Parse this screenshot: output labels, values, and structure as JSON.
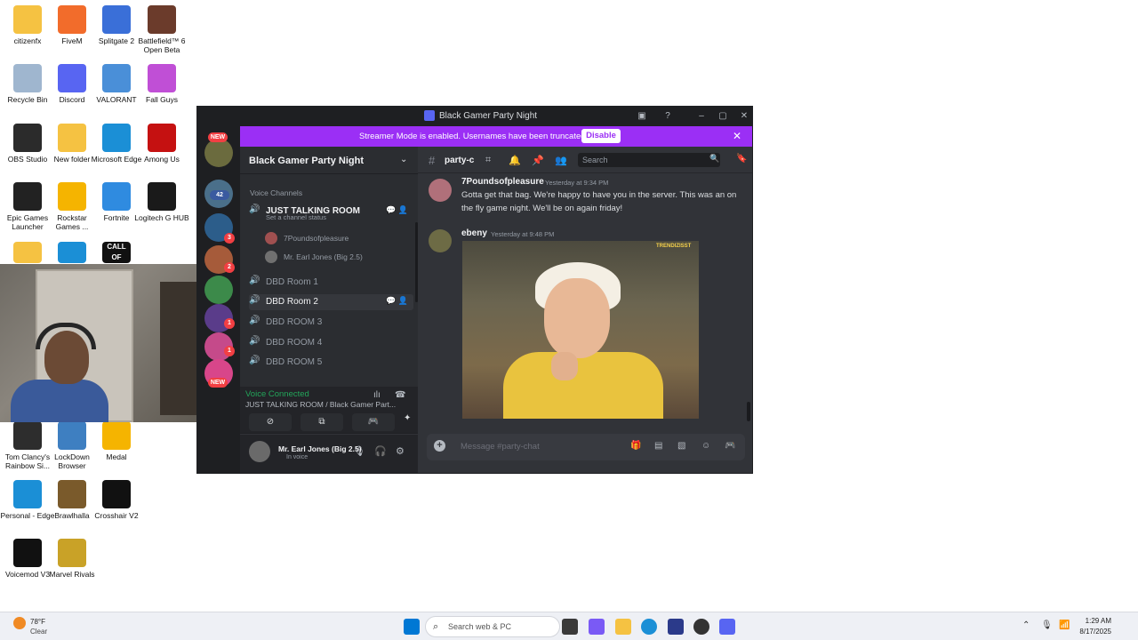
{
  "desktop": {
    "icons": [
      {
        "label": "citizenfx",
        "icon": "folder-icon",
        "color": "#f5c242"
      },
      {
        "label": "FiveM",
        "icon": "fivem-icon",
        "color": "#f26c2b"
      },
      {
        "label": "Splitgate 2",
        "icon": "splitgate-icon",
        "color": "#3a6fd8"
      },
      {
        "label": "Battlefield™ 6 Open Beta",
        "icon": "battlefield-icon",
        "color": "#6b3b2b"
      },
      {
        "label": "Recycle Bin",
        "icon": "recycle-bin-icon",
        "color": "#9fb6cf"
      },
      {
        "label": "Discord",
        "icon": "discord-icon",
        "color": "#5865f2"
      },
      {
        "label": "VALORANT",
        "icon": "valorant-icon",
        "color": "#4a8fd8"
      },
      {
        "label": "Fall Guys",
        "icon": "fall-guys-icon",
        "color": "#c04fd6"
      },
      {
        "label": "OBS Studio",
        "icon": "obs-icon",
        "color": "#2b2b2b"
      },
      {
        "label": "New folder",
        "icon": "folder-icon",
        "color": "#f5c242"
      },
      {
        "label": "Microsoft Edge",
        "icon": "edge-icon",
        "color": "#1b8fd6"
      },
      {
        "label": "Among Us",
        "icon": "among-us-icon",
        "color": "#c51111"
      },
      {
        "label": "Epic Games Launcher",
        "icon": "epic-games-icon",
        "color": "#222222"
      },
      {
        "label": "Rockstar Games ...",
        "icon": "rockstar-icon",
        "color": "#f5b400"
      },
      {
        "label": "Fortnite",
        "icon": "fortnite-icon",
        "color": "#2f8be0"
      },
      {
        "label": "Logitech G HUB",
        "icon": "logitech-icon",
        "color": "#1a1a1a"
      },
      {
        "label": "Tom Clancy's Rainbow Si...",
        "icon": "rainbow-six-icon",
        "color": "#2d2d2d"
      },
      {
        "label": "LockDown Browser",
        "icon": "lockdown-icon",
        "color": "#3e7fc1"
      },
      {
        "label": "Medal",
        "icon": "medal-icon",
        "color": "#f5b400"
      },
      {
        "label": "Personal - Edge",
        "icon": "edge-icon",
        "color": "#1b8fd6"
      },
      {
        "label": "Brawlhalla",
        "icon": "brawlhalla-icon",
        "color": "#7a5a2b"
      },
      {
        "label": "Crosshair V2",
        "icon": "crosshair-icon",
        "color": "#111111"
      },
      {
        "label": "Voicemod V3",
        "icon": "voicemod-icon",
        "color": "#111111"
      },
      {
        "label": "Marvel Rivals",
        "icon": "marvel-rivals-icon",
        "color": "#c9a227"
      }
    ],
    "partial_icons": [
      {
        "icon": "folder-icon",
        "color": "#f5c242"
      },
      {
        "icon": "edge-icon",
        "color": "#1b8fd6"
      },
      {
        "label": "CALL OF DUTY",
        "icon": "call-of-duty-icon",
        "color": "#111111"
      }
    ]
  },
  "discord": {
    "window_title": "Black Gamer Party Night",
    "banner": {
      "text": "Streamer Mode is enabled. Usernames have been truncated.",
      "button": "Disable"
    },
    "servers": {
      "badges": [
        "NEW",
        "42",
        "3",
        "2",
        "1",
        "1",
        "NEW"
      ]
    },
    "server_name": "Black Gamer Party Night",
    "voice_channels_header": "Voice Channels",
    "channels": [
      {
        "name": "JUST TALKING ROOM",
        "status": "Set a channel status"
      },
      {
        "name": "DBD Room 1"
      },
      {
        "name": "DBD Room 2"
      },
      {
        "name": "DBD ROOM 3"
      },
      {
        "name": "DBD ROOM 4"
      },
      {
        "name": "DBD ROOM 5"
      }
    ],
    "members": [
      "7Poundsofpleasure",
      "Mr. Earl Jones (Big 2.5)"
    ],
    "voice": {
      "status": "Voice Connected",
      "location": "JUST TALKING ROOM / Black Gamer Part..."
    },
    "user": {
      "name": "Mr. Earl Jones (Big 2.5)",
      "status": "In voice"
    },
    "chat": {
      "channel": "party-c",
      "search_placeholder": "Search",
      "messages": [
        {
          "author": "7Poundsofpleasure",
          "time": "Yesterday at 9:34 PM",
          "text": "Gotta get that bag. We're happy to have you in the server. This was an on the fly game night. We'll be on again friday!"
        },
        {
          "author": "ebeny",
          "time": "Yesterday at 9:48 PM",
          "gif_watermark": "TRENDIZISST"
        }
      ],
      "composer_placeholder": "Message #party-chat"
    }
  },
  "taskbar": {
    "temperature": "78°F",
    "condition": "Clear",
    "search_placeholder": "Search web & PC",
    "time": "1:29 AM",
    "date": "8/17/2025"
  }
}
